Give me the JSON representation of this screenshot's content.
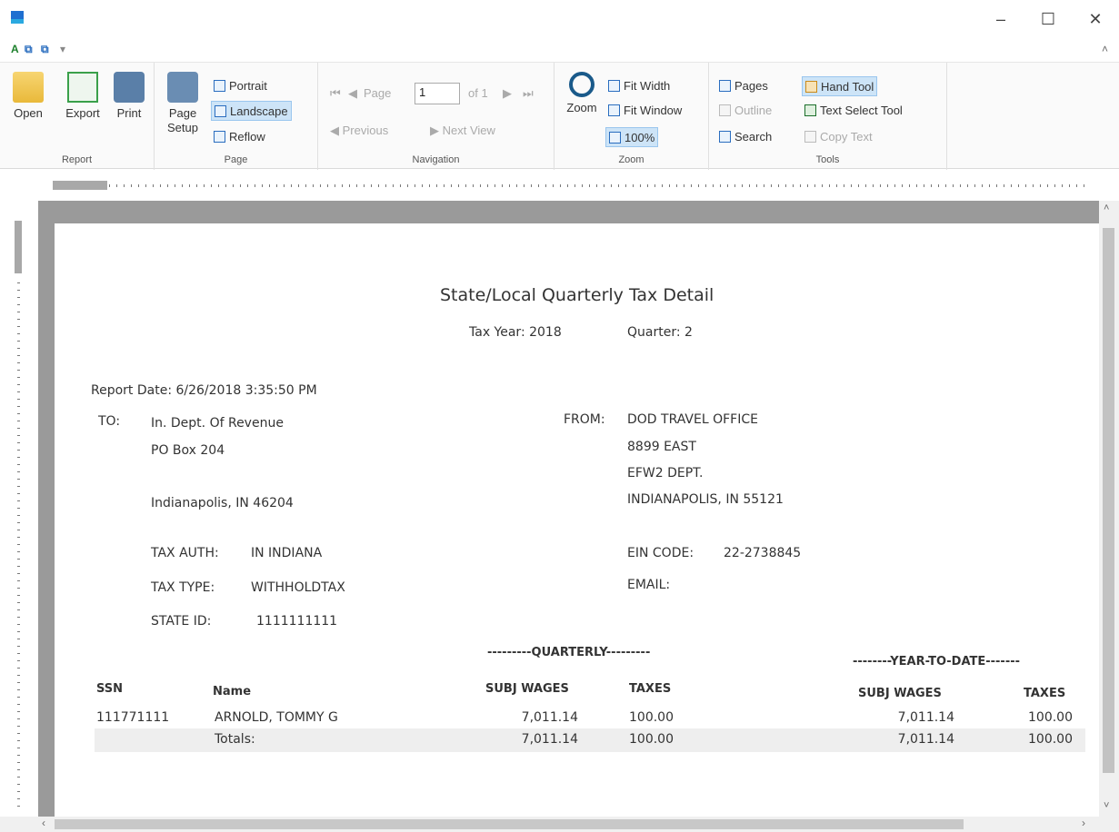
{
  "window": {
    "minimize": "–",
    "maximize": "☐",
    "close": "✕"
  },
  "ribbon": {
    "report": {
      "label": "Report",
      "open": "Open",
      "export": "Export",
      "print": "Print"
    },
    "page": {
      "label": "Page",
      "setup_l1": "Page",
      "setup_l2": "Setup",
      "portrait": "Portrait",
      "landscape": "Landscape",
      "reflow": "Reflow"
    },
    "navigation": {
      "label": "Navigation",
      "page": "Page",
      "page_value": "1",
      "of": "of 1",
      "previous": "Previous",
      "next": "Next View"
    },
    "zoom": {
      "label": "Zoom",
      "zoom": "Zoom",
      "fit_width": "Fit Width",
      "fit_window": "Fit Window",
      "pct": "100%"
    },
    "tools": {
      "label": "Tools",
      "pages": "Pages",
      "outline": "Outline",
      "search": "Search",
      "hand": "Hand Tool",
      "text_select": "Text Select Tool",
      "copy": "Copy Text"
    }
  },
  "report": {
    "title": "State/Local Quarterly Tax Detail",
    "tax_year": "Tax Year: 2018",
    "quarter": "Quarter: 2",
    "report_date": "Report Date: 6/26/2018 3:35:50 PM",
    "to_label": "TO:",
    "to_lines": [
      "In. Dept. Of Revenue",
      "PO Box 204",
      "Indianapolis, IN 46204"
    ],
    "from_label": "FROM:",
    "from_lines": [
      "DOD TRAVEL OFFICE",
      "8899 EAST",
      "EFW2 DEPT.",
      "INDIANAPOLIS, IN 55121"
    ],
    "tax_auth_label": "TAX AUTH:",
    "tax_auth": "IN INDIANA",
    "tax_type_label": "TAX TYPE:",
    "tax_type": "WITHHOLDTAX",
    "state_id_label": "STATE ID:",
    "state_id": "1111111111",
    "ein_label": "EIN CODE:",
    "ein": "22-2738845",
    "email_label": "EMAIL:",
    "quarterly_header": "---------QUARTERLY---------",
    "ytd_header": "--------YEAR-TO-DATE-------",
    "cols": {
      "ssn": "SSN",
      "name": "Name",
      "q_wages": "SUBJ WAGES",
      "q_taxes": "TAXES",
      "y_wages": "SUBJ WAGES",
      "y_taxes": "TAXES"
    },
    "row": {
      "ssn": "111771111",
      "name": "ARNOLD, TOMMY G",
      "q_wages": "7,011.14",
      "q_taxes": "100.00",
      "y_wages": "7,011.14",
      "y_taxes": "100.00"
    },
    "totals": {
      "label": "Totals:",
      "q_wages": "7,011.14",
      "q_taxes": "100.00",
      "y_wages": "7,011.14",
      "y_taxes": "100.00"
    }
  }
}
